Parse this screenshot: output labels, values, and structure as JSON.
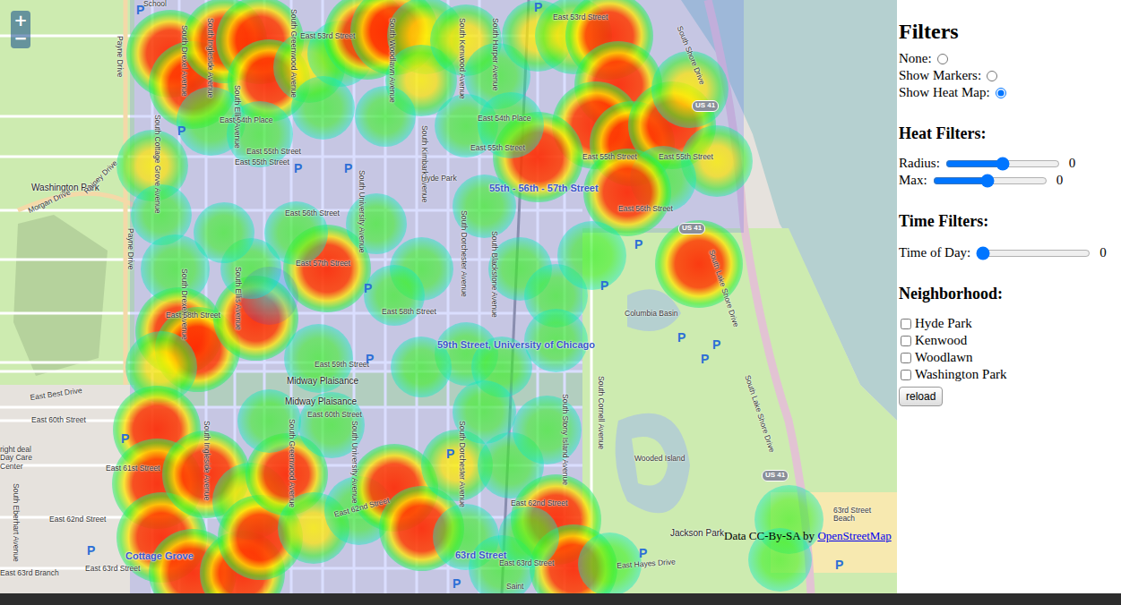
{
  "map": {
    "zoom_in": "+",
    "zoom_out": "−",
    "labels": [
      "School",
      "Payne Drive",
      "Payne Drive",
      "Washington Park",
      "Morgan Drive",
      "Rainey Drive",
      "South Cottage Grove Avenue",
      "South Drexel Avenue",
      "South Ingleside Avenue",
      "South Ellis Avenue",
      "South Greenwood Avenue",
      "East 53rd Street",
      "East 53rd Street",
      "South University Avenue",
      "South Woodlawn Avenue",
      "South Kimbark Avenue",
      "South Kenwood Avenue",
      "South Harper Avenue",
      "South Shore Drive",
      "East 54th Place",
      "East 54th Place",
      "East 55th Street",
      "East 55th Street",
      "East 55th Street",
      "East 55th Street",
      "East 55th Street",
      "Hyde Park",
      "55th - 56th - 57th Street",
      "East 56th Street",
      "East 56th Street",
      "South Dorchester Avenue",
      "South Blackstone Avenue",
      "South Drexel Avenue",
      "South Ellis Avenue",
      "East 57th Street",
      "East 58th Street",
      "East 58th Street",
      "59th Street, University of Chicago",
      "East 59th Street",
      "Midway Plaisance",
      "Midway Plaisance",
      "East 60th Street",
      "East 60th Street",
      "East Best Drive",
      "East 61st Street",
      "South Stony Island Avenue",
      "South Cornell Avenue",
      "South Lake Shore Drive",
      "South Lake Shore Drive",
      "Columbia Basin",
      "Wooded Island",
      "Jackson Park",
      "East Hayes Drive",
      "63rd Street Beach",
      "East 62nd Street",
      "East 62nd Street",
      "East 62nd Street",
      "East 63rd Street",
      "63rd Street",
      "East 63rd Street",
      "Cottage Grove",
      "East 63rd Branch",
      "Saint",
      "right deal Day Care Center",
      "South Eberhart Avenue",
      "South Ingleside Avenue",
      "South Greenwood Avenue",
      "South University Avenue",
      "South Dorchester Avenue"
    ],
    "parking": [
      "P",
      "P",
      "P",
      "P",
      "P",
      "P",
      "P",
      "P",
      "P",
      "P",
      "P",
      "P",
      "P",
      "P",
      "P",
      "P",
      "P",
      "P"
    ],
    "shields": [
      "US 41",
      "US 41",
      "US 41"
    ],
    "attribution": {
      "text": "Data CC-By-SA by ",
      "link": "OpenStreetMap"
    },
    "heat": {
      "points": [
        [
          190,
          60,
          0.9
        ],
        [
          215,
          95,
          0.9
        ],
        [
          250,
          45,
          0.85
        ],
        [
          290,
          45,
          0.9
        ],
        [
          300,
          90,
          0.8
        ],
        [
          345,
          75,
          0.6
        ],
        [
          380,
          60,
          0.5
        ],
        [
          410,
          40,
          0.9
        ],
        [
          440,
          35,
          0.9
        ],
        [
          475,
          40,
          0.7
        ],
        [
          470,
          90,
          0.6
        ],
        [
          520,
          45,
          0.6
        ],
        [
          555,
          85,
          0.5
        ],
        [
          600,
          40,
          0.6
        ],
        [
          640,
          40,
          0.7
        ],
        [
          680,
          40,
          0.9
        ],
        [
          690,
          95,
          0.9
        ],
        [
          665,
          140,
          0.9
        ],
        [
          705,
          160,
          0.85
        ],
        [
          750,
          140,
          0.9
        ],
        [
          770,
          100,
          0.7
        ],
        [
          800,
          180,
          0.6
        ],
        [
          740,
          200,
          0.5
        ],
        [
          700,
          215,
          0.9
        ],
        [
          600,
          175,
          0.95
        ],
        [
          235,
          135,
          0.55
        ],
        [
          290,
          150,
          0.5
        ],
        [
          360,
          120,
          0.45
        ],
        [
          430,
          130,
          0.4
        ],
        [
          520,
          140,
          0.45
        ],
        [
          570,
          140,
          0.5
        ],
        [
          170,
          185,
          0.6
        ],
        [
          180,
          240,
          0.4
        ],
        [
          195,
          300,
          0.55
        ],
        [
          200,
          370,
          0.9
        ],
        [
          220,
          390,
          0.85
        ],
        [
          180,
          410,
          0.6
        ],
        [
          285,
          355,
          0.85
        ],
        [
          280,
          300,
          0.4
        ],
        [
          250,
          260,
          0.4
        ],
        [
          365,
          300,
          0.9
        ],
        [
          330,
          260,
          0.45
        ],
        [
          420,
          250,
          0.4
        ],
        [
          470,
          300,
          0.45
        ],
        [
          440,
          330,
          0.4
        ],
        [
          540,
          230,
          0.45
        ],
        [
          580,
          300,
          0.45
        ],
        [
          620,
          330,
          0.45
        ],
        [
          620,
          380,
          0.45
        ],
        [
          520,
          395,
          0.45
        ],
        [
          355,
          400,
          0.55
        ],
        [
          300,
          330,
          0.35
        ],
        [
          470,
          410,
          0.4
        ],
        [
          560,
          410,
          0.4
        ],
        [
          660,
          285,
          0.55
        ],
        [
          780,
          295,
          0.9
        ],
        [
          175,
          480,
          0.9
        ],
        [
          175,
          540,
          0.95
        ],
        [
          180,
          600,
          0.95
        ],
        [
          215,
          640,
          0.9
        ],
        [
          270,
          640,
          0.85
        ],
        [
          230,
          530,
          0.9
        ],
        [
          280,
          560,
          0.7
        ],
        [
          290,
          600,
          0.85
        ],
        [
          320,
          530,
          0.8
        ],
        [
          350,
          590,
          0.6
        ],
        [
          400,
          570,
          0.55
        ],
        [
          440,
          545,
          0.9
        ],
        [
          470,
          590,
          0.85
        ],
        [
          510,
          520,
          0.6
        ],
        [
          520,
          600,
          0.5
        ],
        [
          570,
          520,
          0.5
        ],
        [
          610,
          480,
          0.55
        ],
        [
          620,
          580,
          0.95
        ],
        [
          640,
          635,
          0.9
        ],
        [
          560,
          635,
          0.5
        ],
        [
          680,
          630,
          0.45
        ],
        [
          300,
          470,
          0.45
        ],
        [
          370,
          475,
          0.5
        ],
        [
          540,
          460,
          0.45
        ],
        [
          880,
          580,
          0.55
        ],
        [
          870,
          625,
          0.45
        ],
        [
          590,
          600,
          0.4
        ]
      ]
    }
  },
  "filters": {
    "title": "Filters",
    "modes": [
      {
        "label": "None:",
        "selected": false
      },
      {
        "label": "Show Markers:",
        "selected": false
      },
      {
        "label": "Show Heat Map:",
        "selected": true
      }
    ],
    "heat_filters": {
      "title": "Heat Filters:",
      "sliders": [
        {
          "label": "Radius:",
          "level": 0.5,
          "reading": "0"
        },
        {
          "label": "Max:",
          "level": 0.48,
          "reading": "0"
        }
      ]
    },
    "time_filters": {
      "title": "Time Filters:",
      "sliders": [
        {
          "label": "Time of Day:",
          "level": 0,
          "reading": "0"
        }
      ]
    },
    "neighborhood": {
      "title": "Neighborhood:",
      "options": [
        {
          "label": "Hyde Park",
          "checked": false
        },
        {
          "label": "Kenwood",
          "checked": false
        },
        {
          "label": "Woodlawn",
          "checked": false
        },
        {
          "label": "Washington Park",
          "checked": false
        }
      ],
      "button": "reload"
    }
  }
}
